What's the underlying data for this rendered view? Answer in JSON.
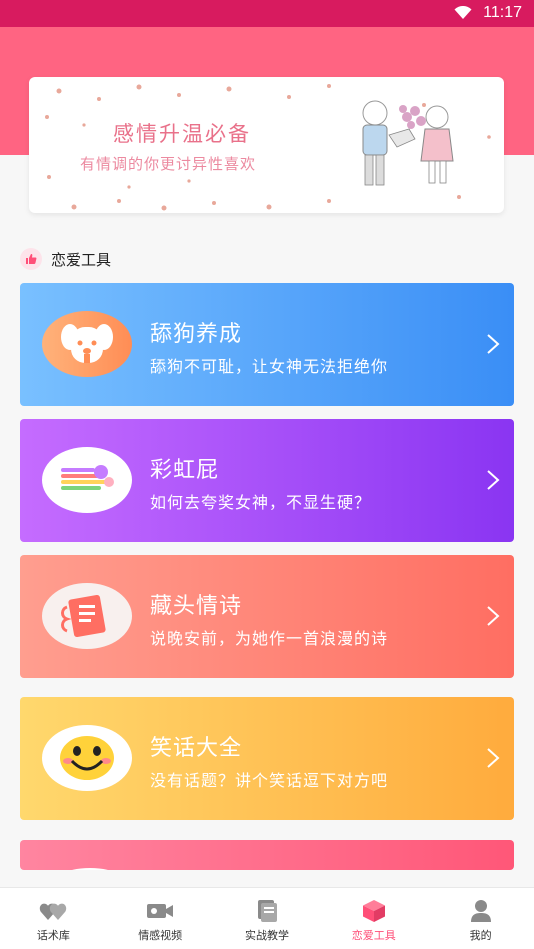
{
  "status_bar": {
    "time": "11:17"
  },
  "banner": {
    "title": "感情升温必备",
    "subtitle": "有情调的你更讨异性喜欢"
  },
  "section": {
    "title": "恋爱工具"
  },
  "cards": [
    {
      "title": "舔狗养成",
      "subtitle": "舔狗不可耻，让女神无法拒绝你",
      "icon": "dog-face-icon"
    },
    {
      "title": "彩虹屁",
      "subtitle": "如何去夸奖女神，不显生硬？",
      "icon": "rainbow-stripes-icon"
    },
    {
      "title": "藏头情诗",
      "subtitle": "说晚安前，为她作一首浪漫的诗",
      "icon": "poem-card-icon"
    },
    {
      "title": "笑话大全",
      "subtitle": "没有话题？讲个笑话逗下对方吧",
      "icon": "smiley-face-icon"
    }
  ],
  "tabbar": {
    "items": [
      {
        "label": "话术库",
        "icon": "hearts-icon",
        "active": false
      },
      {
        "label": "情感视频",
        "icon": "video-camera-icon",
        "active": false
      },
      {
        "label": "实战教学",
        "icon": "book-icon",
        "active": false
      },
      {
        "label": "恋爱工具",
        "icon": "gift-box-icon",
        "active": true
      },
      {
        "label": "我的",
        "icon": "person-icon",
        "active": false
      }
    ]
  },
  "colors": {
    "status_bar": "#d81b5f",
    "header": "#ff6482",
    "accent": "#ff4f78",
    "tab_inactive_icon": "#888888"
  }
}
